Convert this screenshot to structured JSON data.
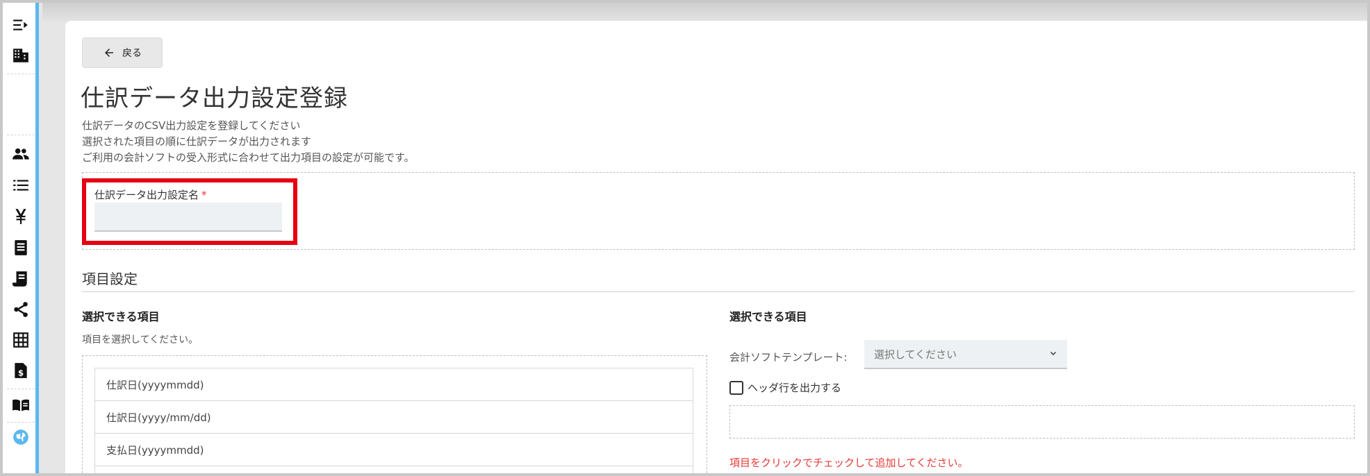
{
  "header": {
    "back_label": "戻る",
    "title": "仕訳データ出力設定登録"
  },
  "description": {
    "line1": "仕訳データのCSV出力設定を登録してください",
    "line2": "選択された項目の順に仕訳データが出力されます",
    "line3": "ご利用の会計ソフトの受入形式に合わせて出力項目の設定が可能です。"
  },
  "name_field": {
    "label": "仕訳データ出力設定名",
    "required_mark": "*",
    "value": ""
  },
  "section": {
    "title": "項目設定"
  },
  "left_column": {
    "title": "選択できる項目",
    "subtitle": "項目を選択してください。",
    "items": [
      "仕訳日(yyyymmdd)",
      "仕訳日(yyyy/mm/dd)",
      "支払日(yyyymmdd)",
      ""
    ]
  },
  "right_column": {
    "title": "選択できる項目",
    "template_label": "会計ソフトテンプレート:",
    "template_selected": "選択してください",
    "header_checkbox_label": "ヘッダ行を出力する",
    "header_checked": false,
    "hint": "項目をクリックでチェックして追加してください。"
  },
  "colors": {
    "accent": "#5bb8ee",
    "highlight": "#e60012",
    "required": "#e53935"
  }
}
